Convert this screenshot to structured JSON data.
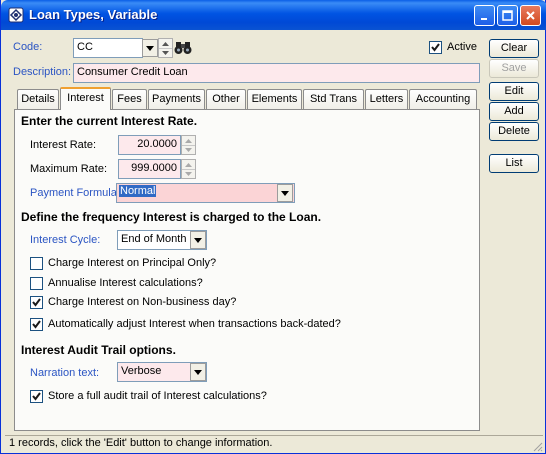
{
  "window": {
    "title": "Loan Types, Variable"
  },
  "code": {
    "label": "Code:",
    "value": "CC"
  },
  "active": {
    "label": "Active",
    "checked": true
  },
  "description": {
    "label": "Description:",
    "value": "Consumer Credit Loan"
  },
  "buttons": {
    "clear": "Clear",
    "save": "Save",
    "edit": "Edit",
    "add": "Add",
    "delete": "Delete",
    "list": "List"
  },
  "tabs": [
    "Details",
    "Interest",
    "Fees",
    "Payments",
    "Other",
    "Elements",
    "Std Trans",
    "Letters",
    "Accounting"
  ],
  "interest": {
    "heading_rate": "Enter the current Interest Rate.",
    "rate_label": "Interest Rate:",
    "rate_value": "20.0000",
    "max_label": "Maximum Rate:",
    "max_value": "999.0000",
    "formula_label": "Payment Formula:",
    "formula_value": "Normal",
    "heading_freq": "Define the frequency Interest is charged to the Loan.",
    "cycle_label": "Interest Cycle:",
    "cycle_value": "End of Month",
    "options": [
      {
        "label": "Charge Interest on Principal Only?",
        "checked": false
      },
      {
        "label": "Annualise Interest calculations?",
        "checked": false
      },
      {
        "label": "Charge Interest on Non-business day?",
        "checked": true
      },
      {
        "label": "Automatically adjust Interest when transactions back-dated?",
        "checked": true
      }
    ],
    "heading_audit": "Interest Audit Trail options.",
    "narration_label": "Narration text:",
    "narration_value": "Verbose",
    "audit_option": {
      "label": "Store a full audit trail of Interest calculations?",
      "checked": true
    }
  },
  "status_text": "1 records, click the 'Edit' button to change information."
}
